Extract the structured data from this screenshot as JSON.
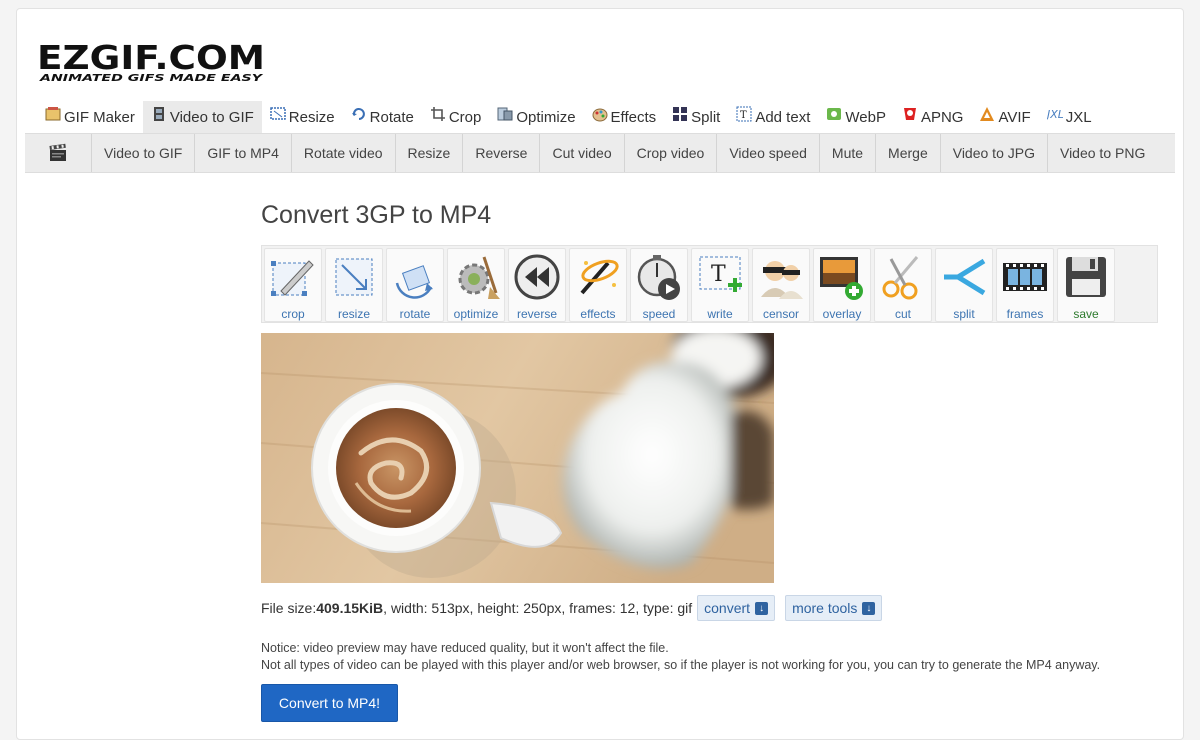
{
  "logo": {
    "main": "EZGIF.COM",
    "tagline": "ANIMATED GIFS MADE EASY"
  },
  "top_nav": [
    {
      "label": "GIF Maker",
      "icon": "gif-maker-icon",
      "active": false
    },
    {
      "label": "Video to GIF",
      "icon": "film-icon",
      "active": true
    },
    {
      "label": "Resize",
      "icon": "resize-icon",
      "active": false
    },
    {
      "label": "Rotate",
      "icon": "rotate-icon",
      "active": false
    },
    {
      "label": "Crop",
      "icon": "crop-icon",
      "active": false
    },
    {
      "label": "Optimize",
      "icon": "optimize-icon",
      "active": false
    },
    {
      "label": "Effects",
      "icon": "palette-icon",
      "active": false
    },
    {
      "label": "Split",
      "icon": "split-icon",
      "active": false
    },
    {
      "label": "Add text",
      "icon": "add-text-icon",
      "active": false
    },
    {
      "label": "WebP",
      "icon": "webp-icon",
      "active": false
    },
    {
      "label": "APNG",
      "icon": "apng-icon",
      "active": false
    },
    {
      "label": "AVIF",
      "icon": "avif-icon",
      "active": false
    },
    {
      "label": "JXL",
      "icon": "jxl-icon",
      "active": false
    }
  ],
  "sub_nav": [
    "Video to GIF",
    "GIF to MP4",
    "Rotate video",
    "Resize",
    "Reverse",
    "Cut video",
    "Crop video",
    "Video speed",
    "Mute",
    "Merge",
    "Video to JPG",
    "Video to PNG"
  ],
  "page_title": "Convert 3GP to MP4",
  "tools": [
    {
      "label": "crop",
      "icon": "crop-tool-icon"
    },
    {
      "label": "resize",
      "icon": "resize-tool-icon"
    },
    {
      "label": "rotate",
      "icon": "rotate-tool-icon"
    },
    {
      "label": "optimize",
      "icon": "optimize-tool-icon"
    },
    {
      "label": "reverse",
      "icon": "reverse-tool-icon"
    },
    {
      "label": "effects",
      "icon": "effects-tool-icon"
    },
    {
      "label": "speed",
      "icon": "speed-tool-icon"
    },
    {
      "label": "write",
      "icon": "write-tool-icon"
    },
    {
      "label": "censor",
      "icon": "censor-tool-icon"
    },
    {
      "label": "overlay",
      "icon": "overlay-tool-icon"
    },
    {
      "label": "cut",
      "icon": "scissors-tool-icon"
    },
    {
      "label": "split",
      "icon": "split-tool-icon"
    },
    {
      "label": "frames",
      "icon": "frames-tool-icon"
    },
    {
      "label": "save",
      "icon": "save-tool-icon"
    }
  ],
  "file_info": {
    "prefix": "File size: ",
    "size": "409.15KiB",
    "details": ", width: 513px, height: 250px, frames: 12, type: gif"
  },
  "buttons": {
    "convert": "convert",
    "more_tools": "more tools",
    "convert_mp4": "Convert to MP4!"
  },
  "notice": {
    "line1": "Notice: video preview may have reduced quality, but it won't affect the file.",
    "line2": "Not all types of video can be played with this player and/or web browser, so if the player is not working for you, you can try to generate the MP4 anyway."
  },
  "colors": {
    "accent": "#1f67c4",
    "link": "#3d74b1",
    "save": "#2d7a2d"
  }
}
